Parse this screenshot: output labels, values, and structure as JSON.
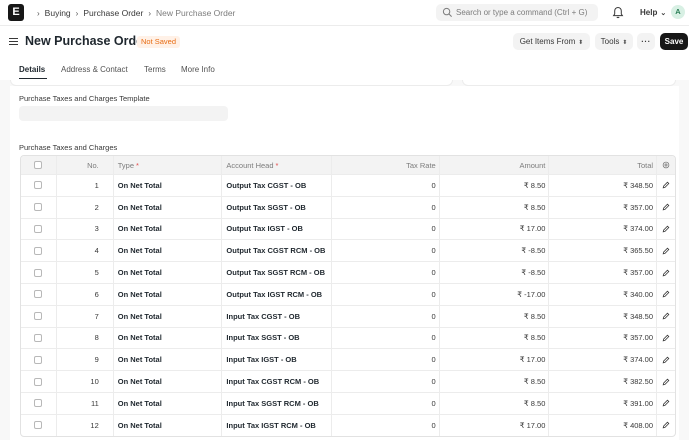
{
  "navbar": {
    "logo_letter": "E",
    "breadcrumbs": [
      "Buying",
      "Purchase Order",
      "New Purchase Order"
    ],
    "search_placeholder": "Search or type a command (Ctrl + G)",
    "help_label": "Help",
    "avatar_initial": "A"
  },
  "page": {
    "title": "New Purchase Order",
    "status_badge": "Not Saved",
    "get_items_label": "Get Items From",
    "tools_label": "Tools",
    "more_label": "···",
    "save_label": "Save"
  },
  "tabs": [
    "Details",
    "Address & Contact",
    "Terms",
    "More Info"
  ],
  "form": {
    "template_label": "Purchase Taxes and Charges Template",
    "template_value": "",
    "table_label": "Purchase Taxes and Charges"
  },
  "table": {
    "headers": {
      "no": "No.",
      "type": "Type",
      "account_head": "Account Head",
      "tax_rate": "Tax Rate",
      "amount": "Amount",
      "total": "Total"
    },
    "rows": [
      {
        "no": "1",
        "type": "On Net Total",
        "account": "Output Tax CGST - OB",
        "rate": "0",
        "amount": "₹ 8.50",
        "total": "₹ 348.50"
      },
      {
        "no": "2",
        "type": "On Net Total",
        "account": "Output Tax SGST - OB",
        "rate": "0",
        "amount": "₹ 8.50",
        "total": "₹ 357.00"
      },
      {
        "no": "3",
        "type": "On Net Total",
        "account": "Output Tax IGST - OB",
        "rate": "0",
        "amount": "₹ 17.00",
        "total": "₹ 374.00"
      },
      {
        "no": "4",
        "type": "On Net Total",
        "account": "Output Tax CGST RCM - OB",
        "rate": "0",
        "amount": "₹ -8.50",
        "total": "₹ 365.50"
      },
      {
        "no": "5",
        "type": "On Net Total",
        "account": "Output Tax SGST RCM - OB",
        "rate": "0",
        "amount": "₹ -8.50",
        "total": "₹ 357.00"
      },
      {
        "no": "6",
        "type": "On Net Total",
        "account": "Output Tax IGST RCM - OB",
        "rate": "0",
        "amount": "₹ -17.00",
        "total": "₹ 340.00"
      },
      {
        "no": "7",
        "type": "On Net Total",
        "account": "Input Tax CGST - OB",
        "rate": "0",
        "amount": "₹ 8.50",
        "total": "₹ 348.50"
      },
      {
        "no": "8",
        "type": "On Net Total",
        "account": "Input Tax SGST - OB",
        "rate": "0",
        "amount": "₹ 8.50",
        "total": "₹ 357.00"
      },
      {
        "no": "9",
        "type": "On Net Total",
        "account": "Input Tax IGST - OB",
        "rate": "0",
        "amount": "₹ 17.00",
        "total": "₹ 374.00"
      },
      {
        "no": "10",
        "type": "On Net Total",
        "account": "Input Tax CGST RCM - OB",
        "rate": "0",
        "amount": "₹ 8.50",
        "total": "₹ 382.50"
      },
      {
        "no": "11",
        "type": "On Net Total",
        "account": "Input Tax SGST RCM - OB",
        "rate": "0",
        "amount": "₹ 8.50",
        "total": "₹ 391.00"
      },
      {
        "no": "12",
        "type": "On Net Total",
        "account": "Input Tax IGST RCM - OB",
        "rate": "0",
        "amount": "₹ 17.00",
        "total": "₹ 408.00"
      }
    ]
  },
  "colors": {
    "primary_button": "#171717",
    "badge_text": "#e86c13",
    "badge_bg": "#fff1e7",
    "required_marker": "#e24c4c"
  }
}
